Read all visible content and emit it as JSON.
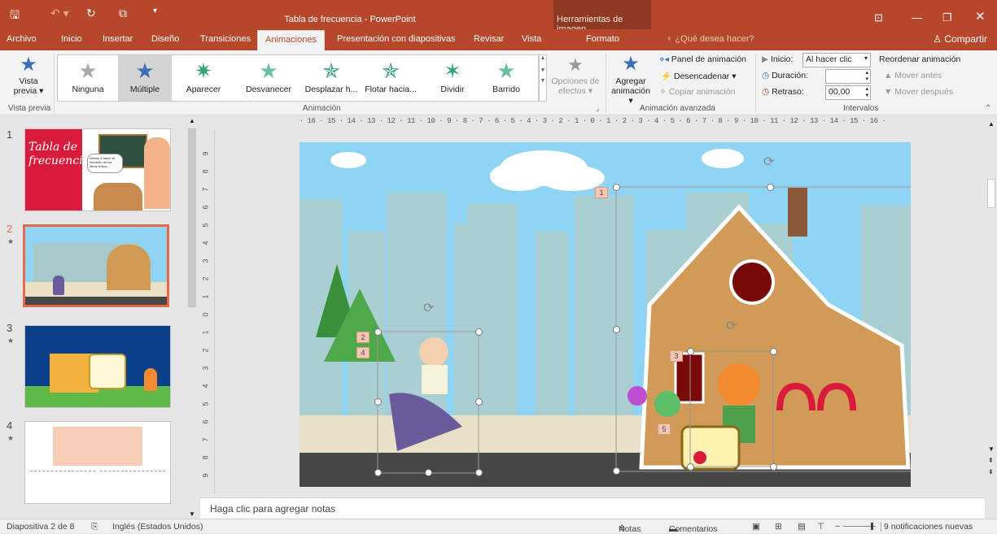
{
  "window": {
    "title": "Tabla de frecuencia - PowerPoint",
    "context_header": "Herramientas de imagen"
  },
  "qat": {
    "save": "save-icon",
    "undo": "undo-icon",
    "redo": "redo-icon",
    "present": "present-icon"
  },
  "tabs": {
    "file": "Archivo",
    "home": "Inicio",
    "insert": "Insertar",
    "design": "Diseño",
    "transitions": "Transiciones",
    "animations": "Animaciones",
    "slideshow": "Presentación con diapositivas",
    "review": "Revisar",
    "view": "Vista",
    "format": "Formato",
    "tell": "¿Qué desea hacer?",
    "share": "Compartir"
  },
  "ribbon": {
    "preview": {
      "line1": "Vista",
      "line2": "previa ▾",
      "group": "Vista previa"
    },
    "gallery": [
      "Ninguna",
      "Múltiple",
      "Aparecer",
      "Desvanecer",
      "Desplazar h...",
      "Flotar hacia...",
      "Dividir",
      "Barrido"
    ],
    "effects_options": {
      "line1": "Opciones de",
      "line2": "efectos ▾"
    },
    "group_animation": "Animación",
    "add_animation": {
      "line1": "Agregar",
      "line2": "animación ▾"
    },
    "anim_pane": "Panel de animación",
    "trigger": "Desencadenar ▾",
    "copy_anim": "Copiar animación",
    "group_advanced": "Animación avanzada",
    "start_label": "Inicio:",
    "start_value": "Al hacer clic",
    "duration_label": "Duración:",
    "duration_value": "",
    "delay_label": "Retraso:",
    "delay_value": "00,00",
    "reorder": "Reordenar animación",
    "move_earlier": "▲ Mover antes",
    "move_later": "▼ Mover después",
    "group_timing": "Intervalos"
  },
  "slides": [
    {
      "num": "1",
      "star": "",
      "title_text": "Tabla de frecuencias",
      "bubble": "Vamos a hacer el recuento de los libros leídos"
    },
    {
      "num": "2",
      "star": "★"
    },
    {
      "num": "3",
      "star": "★"
    },
    {
      "num": "4",
      "star": "★"
    }
  ],
  "ruler": {
    "h": "· 16 · 15 · 14 · 13 · 12 · 11 · 10 · 9 · 8 · 7 · 6 · 5 · 4 · 3 · 2 · 1 · 0 · 1 · 2 · 3 · 4 · 5 · 6 · 7 · 8 · 9 · 10 · 11 · 12 · 13 · 14 · 15 · 16 ·",
    "v": [
      "9",
      "8",
      "7",
      "6",
      "5",
      "4",
      "3",
      "2",
      "1",
      "0",
      "1",
      "2",
      "3",
      "4",
      "5",
      "6",
      "7",
      "8",
      "9"
    ]
  },
  "anim_tags": [
    "1",
    "2",
    "4",
    "3",
    "5"
  ],
  "notes_placeholder": "Haga clic para agregar notas",
  "status": {
    "slide": "Diapositiva 2 de 8",
    "lang": "Inglés (Estados Unidos)",
    "notes": "Notas",
    "comments": "Comentarios",
    "notifications": "9 notificaciones nuevas"
  },
  "colors": {
    "accent": "#b7472a",
    "sky": "#8fd4f2",
    "selected_thumb": "#e86a4a"
  }
}
